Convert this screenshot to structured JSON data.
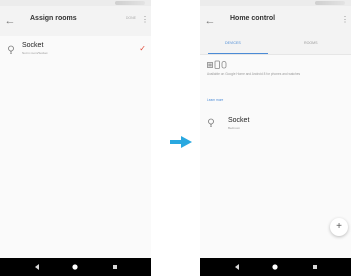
{
  "left_screen": {
    "appbar": {
      "title": "Assign rooms",
      "action": "DONE"
    },
    "row": {
      "title": "Socket",
      "subtitle": "Not in room/Socket"
    }
  },
  "right_screen": {
    "appbar": {
      "title": "Home control"
    },
    "tabs": [
      {
        "label": "DEVICES"
      },
      {
        "label": "ROOMS"
      }
    ],
    "info_text": "Available on Google Home and Android 8 for phones and watches",
    "learn_more": "Learn more",
    "row": {
      "title": "Socket",
      "subtitle": "Bedroom"
    }
  },
  "colors": {
    "accent": "#4b8bd6",
    "arrow": "#29a8e0",
    "check": "#e04b3a",
    "navbar": "#000000"
  },
  "icons": {
    "back": "arrow-left-icon",
    "menu": "more-vert-icon",
    "device": "lightbulb-icon",
    "done": "check-icon",
    "add": "plus-icon",
    "transition": "arrow-right-icon"
  }
}
